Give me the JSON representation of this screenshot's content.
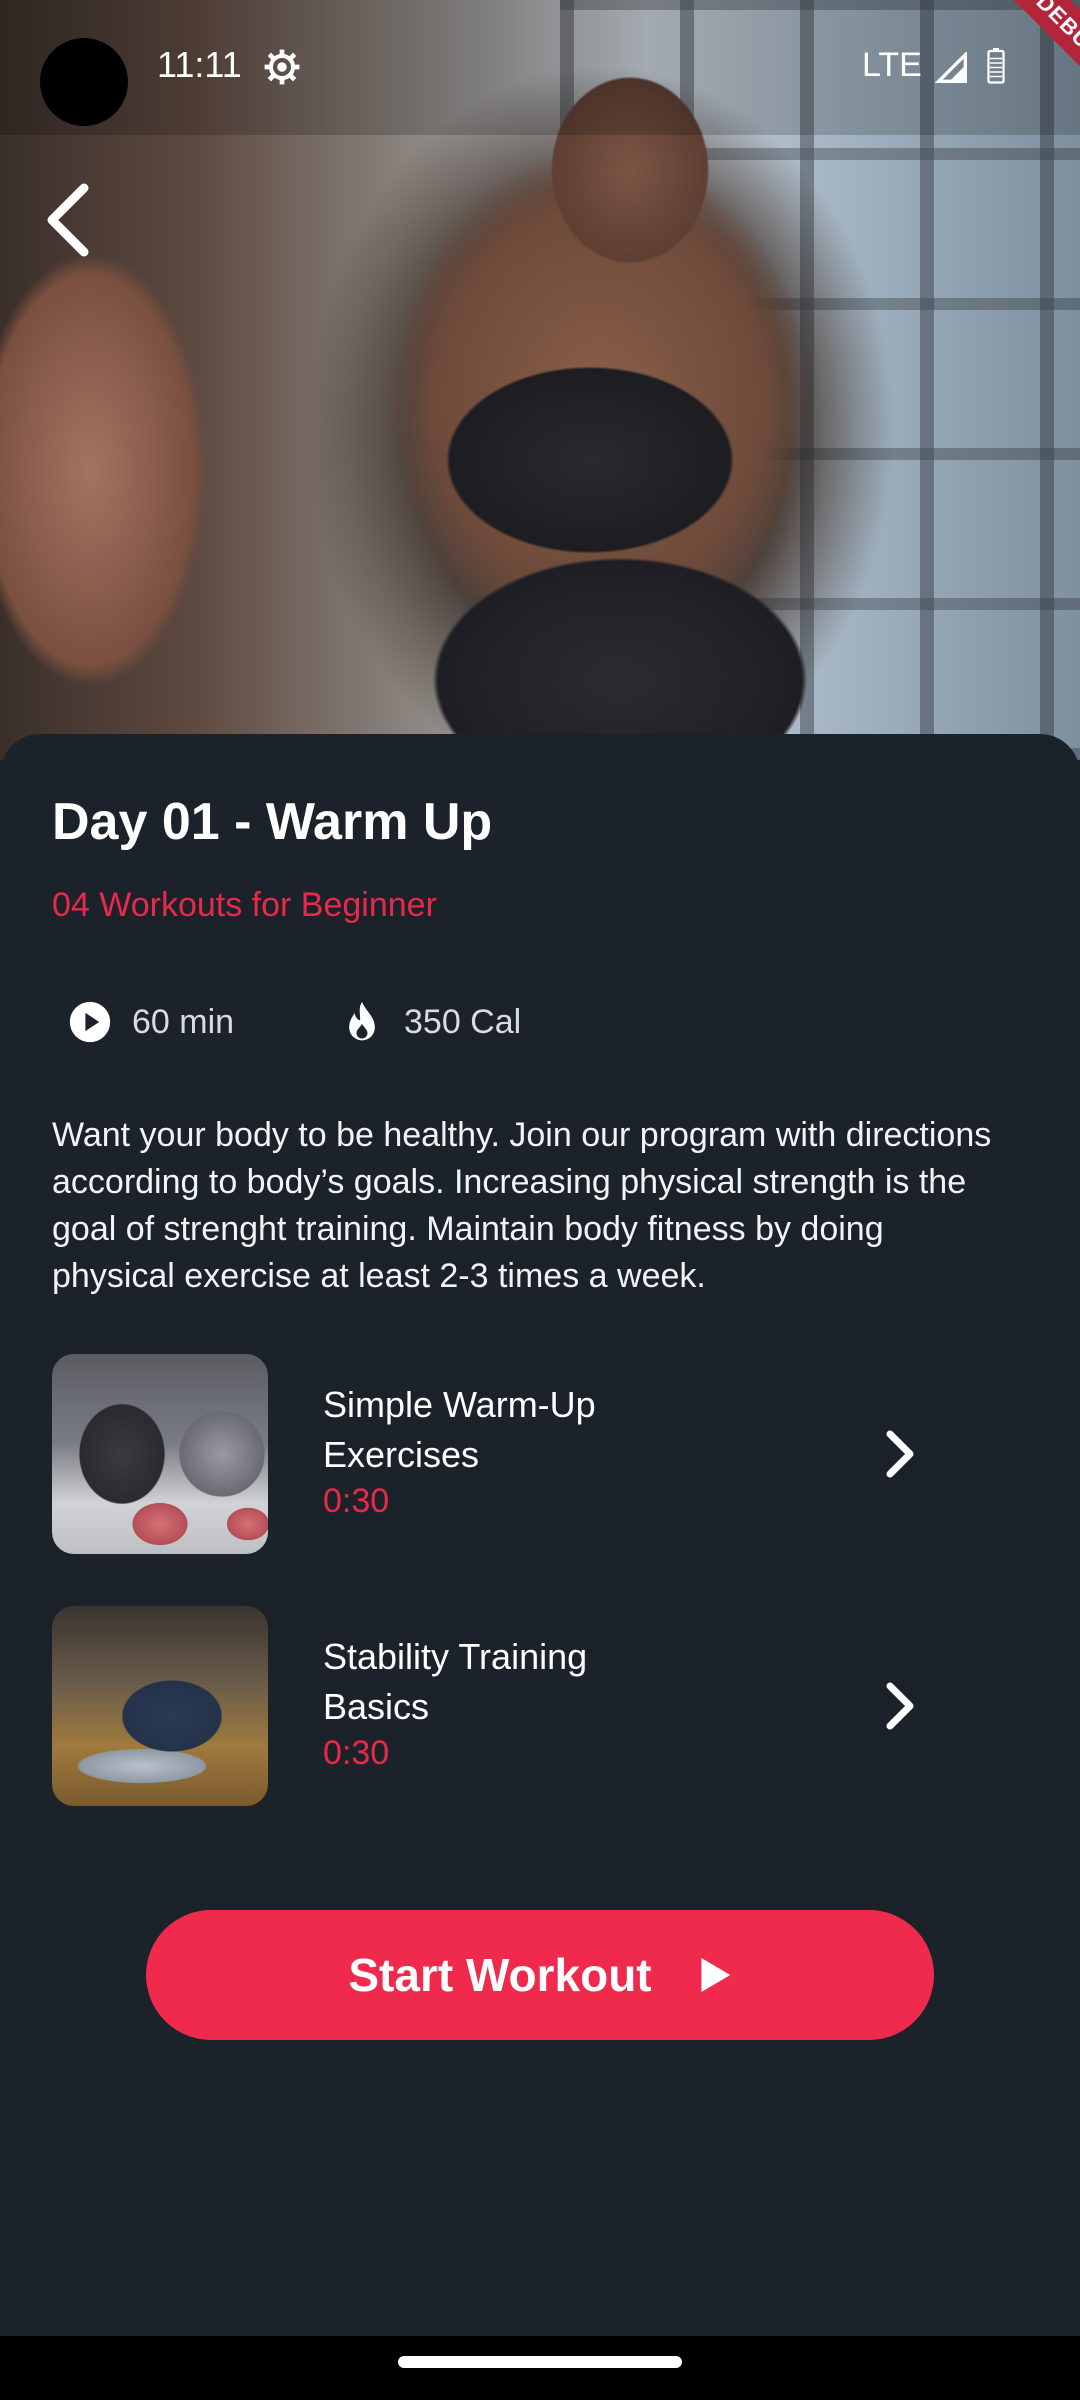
{
  "status_bar": {
    "time": "11:11",
    "network": "LTE",
    "debug_label": "DEBUG",
    "icons": [
      "camera-cutout",
      "gear-icon",
      "signal-icon",
      "battery-icon"
    ]
  },
  "hero": {
    "image": "woman-workout-photo",
    "back_icon": "chevron-left-icon"
  },
  "workout": {
    "title": "Day 01 - Warm Up",
    "subtitle": "04 Workouts for Beginner",
    "stats": {
      "duration": "60 min",
      "calories": "350 Cal"
    },
    "description": "Want your body to be healthy. Join our program with directions according to body’s goals. Increasing physical strength is the goal of strenght training. Maintain body fitness by doing physical exercise at least 2-3 times a week."
  },
  "exercises": [
    {
      "name": "Simple Warm-Up Exercises",
      "duration": "0:30",
      "thumbnail": "medicine-ball-pushup-photo"
    },
    {
      "name": "Stability Training Basics",
      "duration": "0:30",
      "thumbnail": "man-stretching-photo"
    }
  ],
  "actions": {
    "start_label": "Start Workout"
  },
  "colors": {
    "accent": "#ef2a4c",
    "background": "#1c222a",
    "text": "#ffffff",
    "debug_ribbon": "#b3263a"
  }
}
